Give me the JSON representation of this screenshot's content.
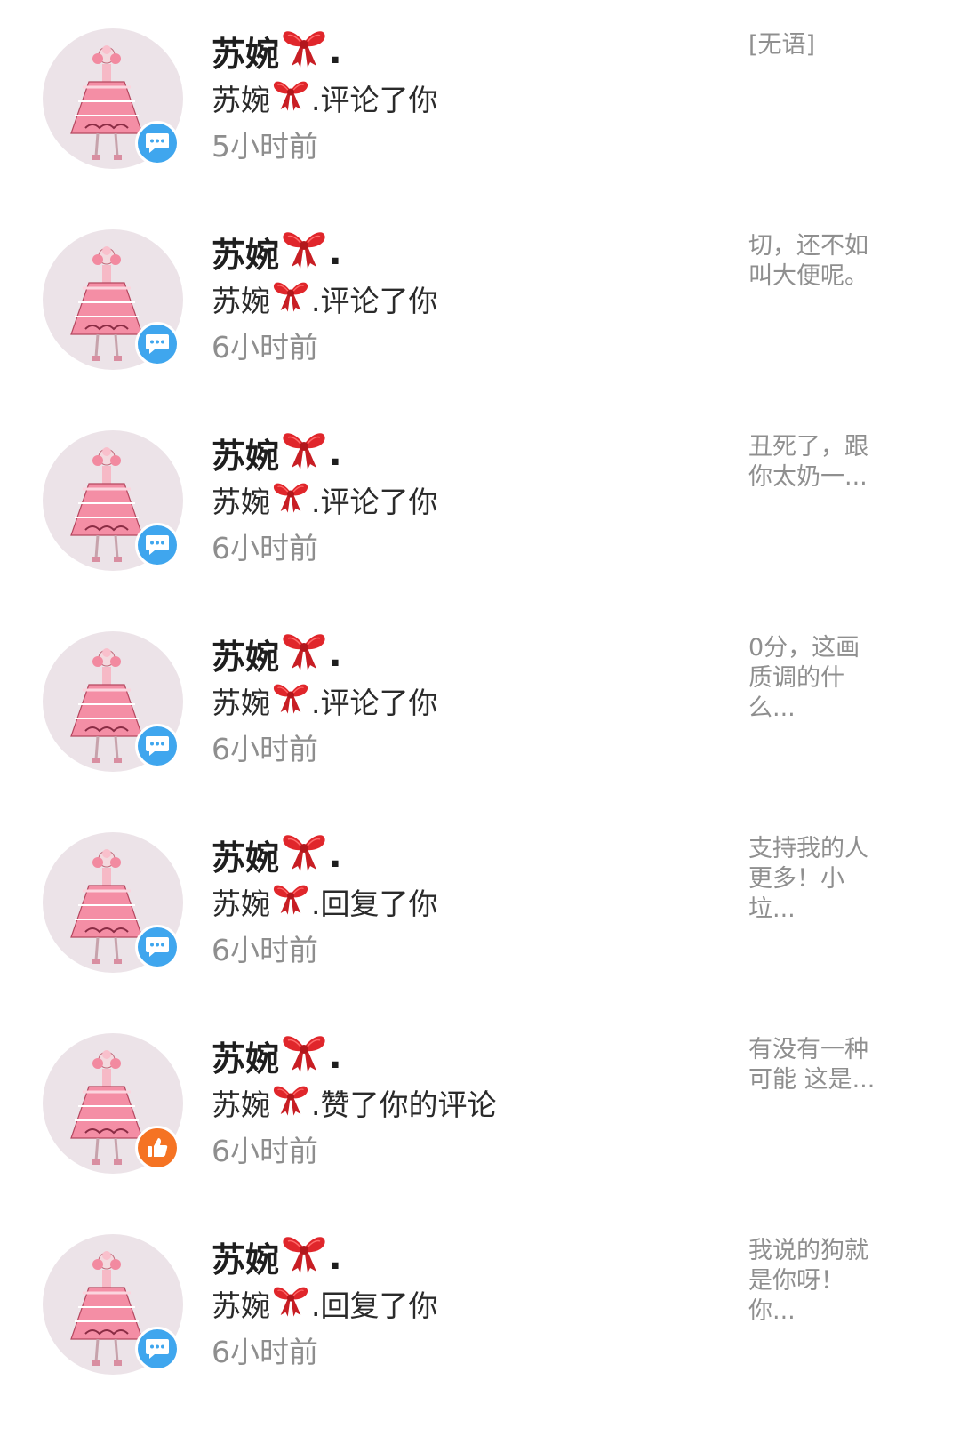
{
  "notifications": [
    {
      "name": "苏婉",
      "name_suffix": ".",
      "actor": "苏婉",
      "action": ".评论了你",
      "time": "5小时前",
      "badge_icon": "comment-icon",
      "preview": "[无语]"
    },
    {
      "name": "苏婉",
      "name_suffix": ".",
      "actor": "苏婉",
      "action": ".评论了你",
      "time": "6小时前",
      "badge_icon": "comment-icon",
      "preview": "切，还不如叫大便呢。"
    },
    {
      "name": "苏婉",
      "name_suffix": ".",
      "actor": "苏婉",
      "action": ".评论了你",
      "time": "6小时前",
      "badge_icon": "comment-icon",
      "preview": "丑死了，跟你太奶一..."
    },
    {
      "name": "苏婉",
      "name_suffix": ".",
      "actor": "苏婉",
      "action": ".评论了你",
      "time": "6小时前",
      "badge_icon": "comment-icon",
      "preview": "0分，这画质调的什么..."
    },
    {
      "name": "苏婉",
      "name_suffix": ".",
      "actor": "苏婉",
      "action": ".回复了你",
      "time": "6小时前",
      "badge_icon": "comment-icon",
      "preview": "支持我的人更多！小垃..."
    },
    {
      "name": "苏婉",
      "name_suffix": ".",
      "actor": "苏婉",
      "action": ".赞了你的评论",
      "time": "6小时前",
      "badge_icon": "thumbs-up-icon",
      "preview": "有没有一种可能 这是..."
    },
    {
      "name": "苏婉",
      "name_suffix": ".",
      "actor": "苏婉",
      "action": ".回复了你",
      "time": "6小时前",
      "badge_icon": "comment-icon",
      "preview": "我说的狗就是你呀！你..."
    }
  ],
  "colors": {
    "comment_badge": "#3fa6ee",
    "like_badge": "#f57323",
    "bow": "#e0262b",
    "avatar_bg": "#ece3e8"
  }
}
